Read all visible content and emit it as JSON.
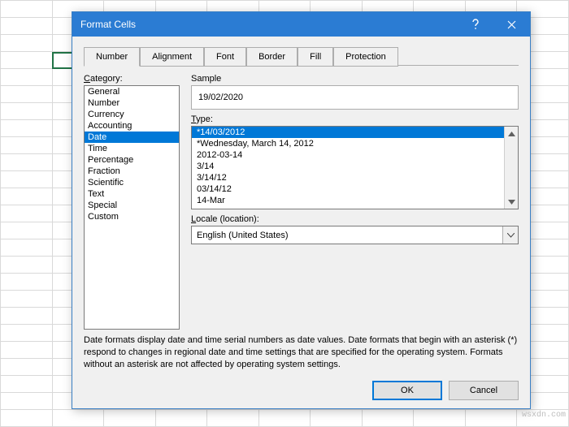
{
  "dialog": {
    "title": "Format Cells",
    "help_icon": "help-icon",
    "close_icon": "close-icon"
  },
  "tabs": [
    {
      "label": "Number",
      "active": true
    },
    {
      "label": "Alignment",
      "active": false
    },
    {
      "label": "Font",
      "active": false
    },
    {
      "label": "Border",
      "active": false
    },
    {
      "label": "Fill",
      "active": false
    },
    {
      "label": "Protection",
      "active": false
    }
  ],
  "category": {
    "label": "Category:",
    "items": [
      "General",
      "Number",
      "Currency",
      "Accounting",
      "Date",
      "Time",
      "Percentage",
      "Fraction",
      "Scientific",
      "Text",
      "Special",
      "Custom"
    ],
    "selected": "Date"
  },
  "sample": {
    "label": "Sample",
    "value": "19/02/2020"
  },
  "type": {
    "label": "Type:",
    "items": [
      "*14/03/2012",
      "*Wednesday, March 14, 2012",
      "2012-03-14",
      "3/14",
      "3/14/12",
      "03/14/12",
      "14-Mar"
    ],
    "selected": "*14/03/2012"
  },
  "locale": {
    "label": "Locale (location):",
    "value": "English (United States)"
  },
  "description": "Date formats display date and time serial numbers as date values. Date formats that begin with an asterisk (*) respond to changes in regional date and time settings that are specified for the operating system. Formats without an asterisk are not affected by operating system settings.",
  "buttons": {
    "ok": "OK",
    "cancel": "Cancel"
  },
  "watermark": "wsxdn.com"
}
